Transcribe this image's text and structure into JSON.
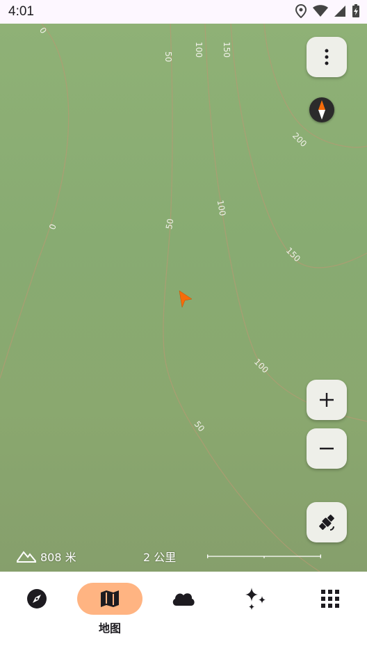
{
  "status_bar": {
    "time": "4:01",
    "icons": [
      "location-icon",
      "wifi-icon",
      "cellular-signal-icon",
      "battery-charging-icon"
    ]
  },
  "map": {
    "contour_labels": [
      "0",
      "100",
      "150",
      "50",
      "200",
      "0",
      "100",
      "50",
      "150",
      "100",
      "50"
    ],
    "elevation": "808 米",
    "scale_label": "2 公里",
    "colors": {
      "land": "#8aab72",
      "contour": "#b59a73",
      "position_arrow": "#f56c0a"
    }
  },
  "controls": {
    "menu_icon": "more-vert-icon",
    "compass_icon": "compass-icon",
    "zoom_in_icon": "plus-icon",
    "zoom_out_icon": "minus-icon",
    "layer_icon": "satellite-icon"
  },
  "nav": {
    "items": [
      {
        "id": "explore",
        "icon": "compass-nav-icon",
        "label": ""
      },
      {
        "id": "map",
        "icon": "map-icon",
        "label": "地图",
        "active": true
      },
      {
        "id": "weather",
        "icon": "cloud-icon",
        "label": ""
      },
      {
        "id": "ai",
        "icon": "sparkles-icon",
        "label": ""
      },
      {
        "id": "apps",
        "icon": "grid-icon",
        "label": ""
      }
    ],
    "active_color": "#ffb482"
  }
}
